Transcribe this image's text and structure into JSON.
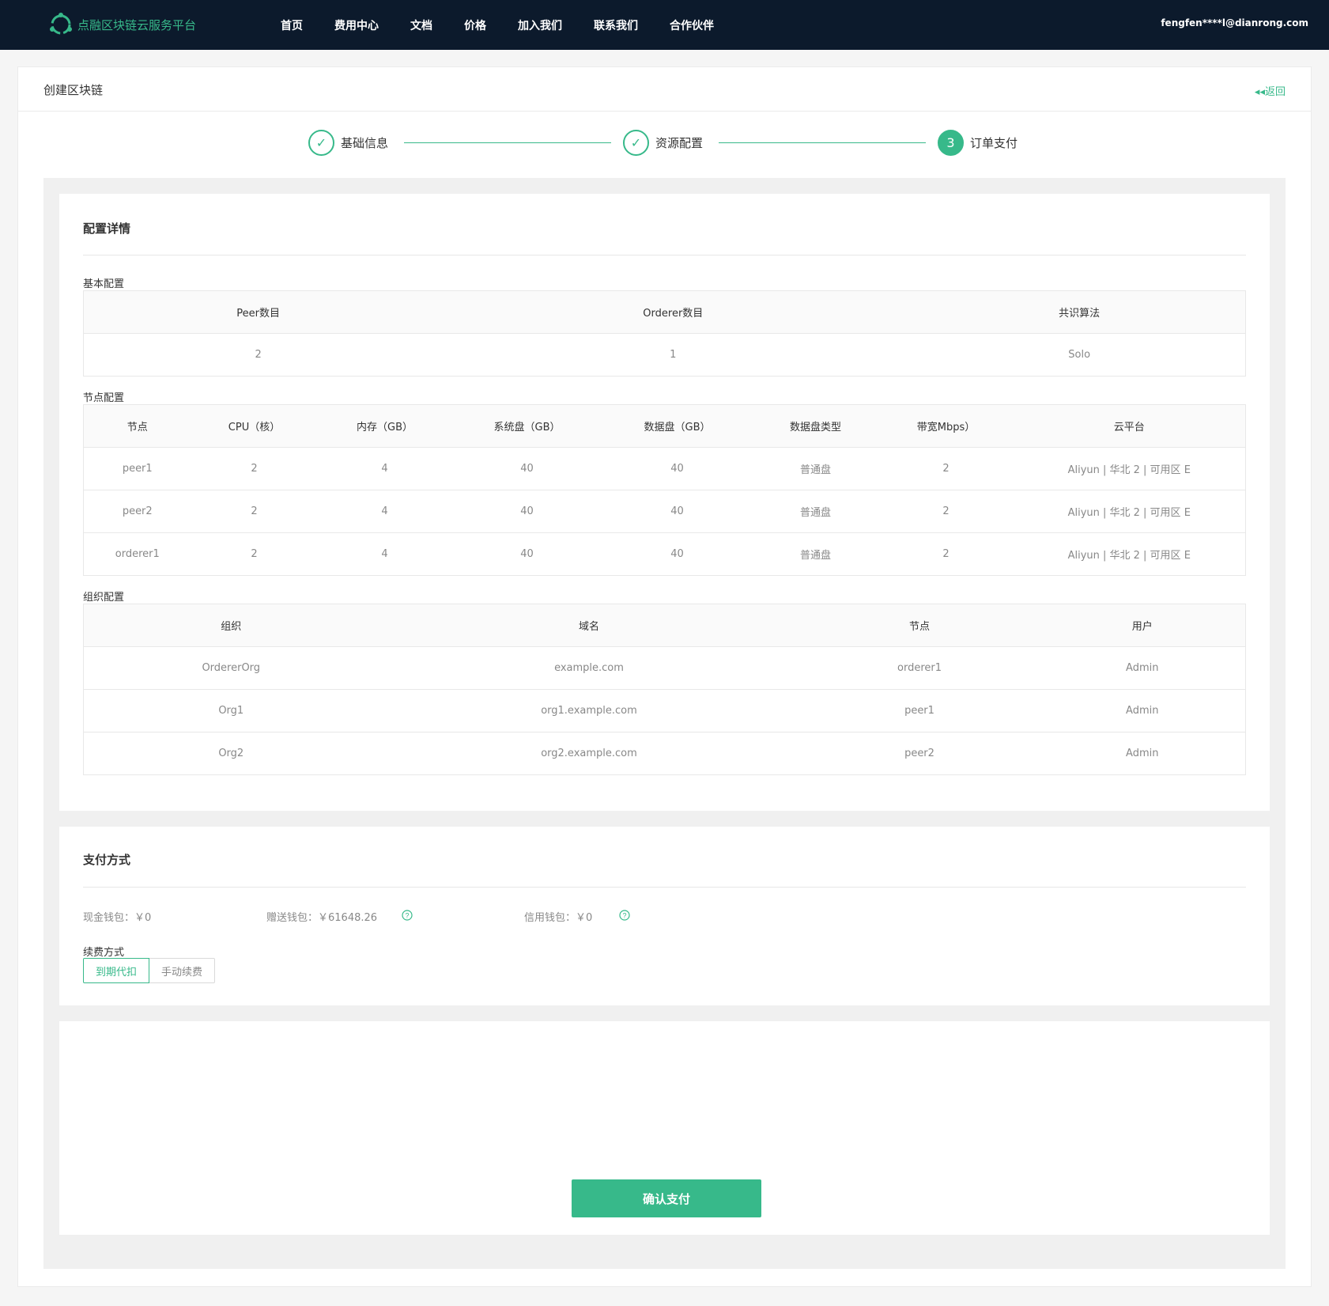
{
  "brand": {
    "name": "点融区块链云服务平台"
  },
  "nav": {
    "items": [
      "首页",
      "费用中心",
      "文档",
      "价格",
      "加入我们",
      "联系我们",
      "合作伙伴"
    ]
  },
  "user": {
    "email": "fengfen****l@dianrong.com"
  },
  "page": {
    "title": "创建区块链",
    "back_label": "返回"
  },
  "steps": [
    {
      "label": "基础信息",
      "state": "done"
    },
    {
      "label": "资源配置",
      "state": "done"
    },
    {
      "label": "订单支付",
      "state": "active",
      "number": "3"
    }
  ],
  "config": {
    "title": "配置详情",
    "basic": {
      "label": "基本配置",
      "headers": [
        "Peer数目",
        "Orderer数目",
        "共识算法"
      ],
      "row": [
        "2",
        "1",
        "Solo"
      ]
    },
    "nodes": {
      "label": "节点配置",
      "headers": [
        "节点",
        "CPU（核）",
        "内存（GB）",
        "系统盘（GB）",
        "数据盘（GB）",
        "数据盘类型",
        "带宽Mbps）",
        "云平台"
      ],
      "rows": [
        [
          "peer1",
          "2",
          "4",
          "40",
          "40",
          "普通盘",
          "2",
          "Aliyun | 华北 2 | 可用区 E"
        ],
        [
          "peer2",
          "2",
          "4",
          "40",
          "40",
          "普通盘",
          "2",
          "Aliyun | 华北 2 | 可用区 E"
        ],
        [
          "orderer1",
          "2",
          "4",
          "40",
          "40",
          "普通盘",
          "2",
          "Aliyun | 华北 2 | 可用区 E"
        ]
      ]
    },
    "orgs": {
      "label": "组织配置",
      "headers": [
        "组织",
        "域名",
        "节点",
        "用户"
      ],
      "rows": [
        [
          "OrdererOrg",
          "example.com",
          "orderer1",
          "Admin"
        ],
        [
          "Org1",
          "org1.example.com",
          "peer1",
          "Admin"
        ],
        [
          "Org2",
          "org2.example.com",
          "peer2",
          "Admin"
        ]
      ]
    }
  },
  "payment": {
    "title": "支付方式",
    "cash_wallet": "现金钱包：￥0",
    "gift_wallet": "赠送钱包：￥61648.26",
    "credit_wallet": "信用钱包：￥0",
    "renew_label": "续费方式",
    "renew_options": [
      "到期代扣",
      "手动续费"
    ],
    "renew_selected": "到期代扣"
  },
  "confirm_label": "确认支付",
  "colors": {
    "accent": "#37b98a",
    "topbar": "#0c1a2c"
  }
}
